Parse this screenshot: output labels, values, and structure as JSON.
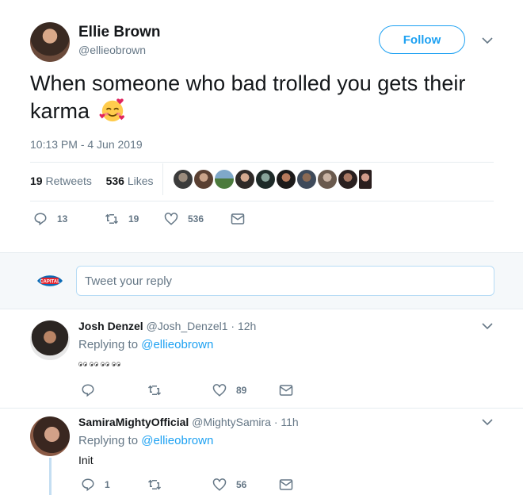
{
  "tweet": {
    "author_name": "Ellie Brown",
    "author_handle": "@ellieobrown",
    "follow_label": "Follow",
    "text": "When someone who bad trolled you gets their karma",
    "emoji": "smiling-face-with-hearts",
    "timestamp": "10:13 PM - 4 Jun 2019",
    "retweets_count": "19",
    "retweets_label": "Retweets",
    "likes_count": "536",
    "likes_label": "Likes",
    "liker_avatar_count": 10,
    "actions": {
      "reply_count": "13",
      "retweet_count": "19",
      "like_count": "536"
    }
  },
  "reply_box": {
    "placeholder": "Tweet your reply",
    "brand": "95-106 CAPITAL FM"
  },
  "replies": [
    {
      "name": "Josh Denzel",
      "handle_time": "@Josh_Denzel1 · 12h",
      "replying_prefix": "Replying to",
      "replying_to": "@ellieobrown",
      "text": "",
      "emoji": "eyes x8",
      "reply_count": "",
      "retweet_count": "",
      "like_count": "89"
    },
    {
      "name": "SamiraMightyOfficial",
      "handle_time": "@MightySamira · 11h",
      "replying_prefix": "Replying to",
      "replying_to": "@ellieobrown",
      "text": "Init",
      "reply_count": "1",
      "retweet_count": "",
      "like_count": "56"
    }
  ],
  "colors": {
    "accent": "#1da1f2",
    "muted": "#657786",
    "divider": "#e6ecf0",
    "reply_bg": "#f5f8fa"
  }
}
